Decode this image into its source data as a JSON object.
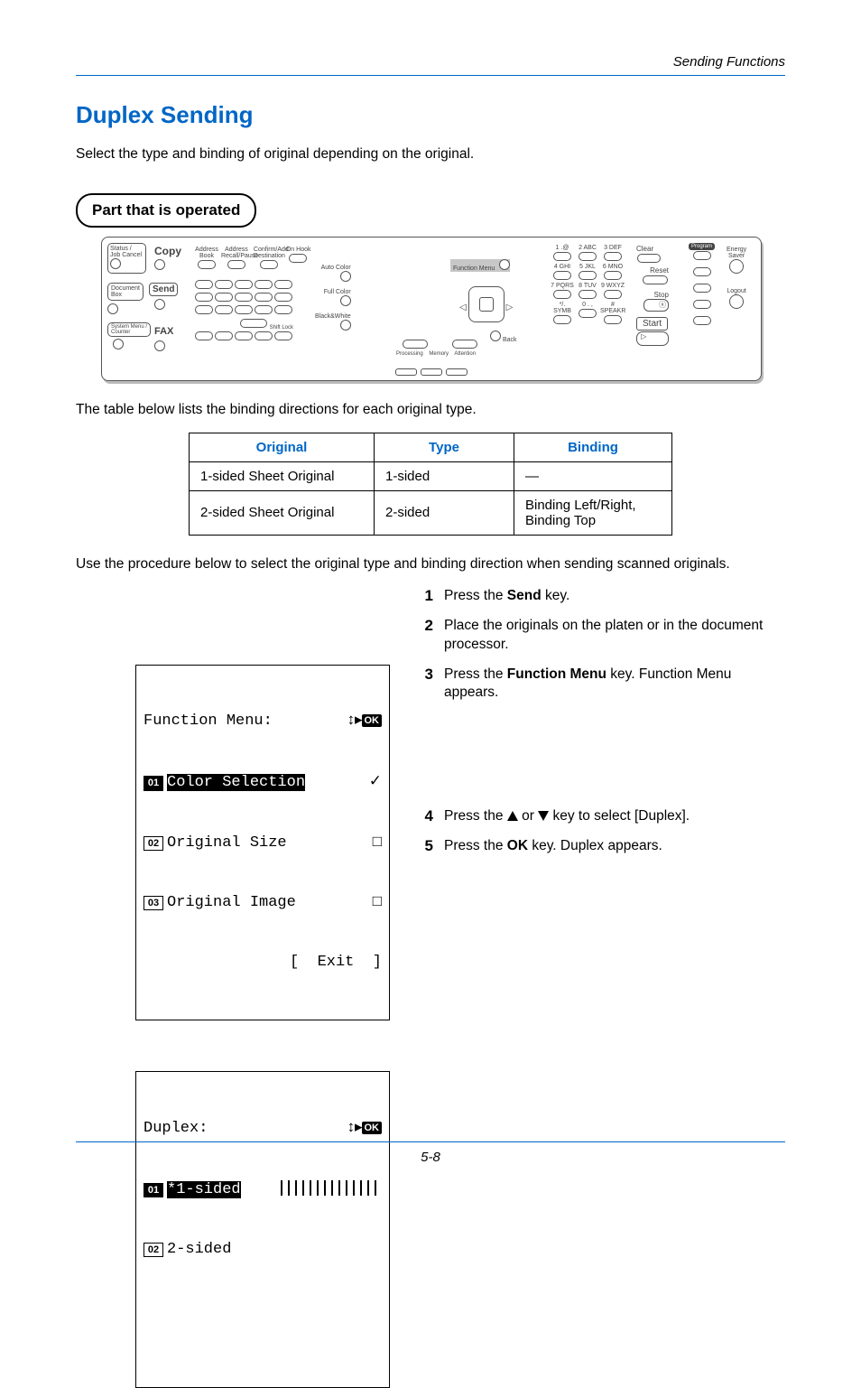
{
  "runhead": "Sending Functions",
  "h1": "Duplex Sending",
  "intro": "Select the type and binding of original depending on the original.",
  "pill": "Part that is operated",
  "panel": {
    "mode_labels": {
      "copy": "Copy",
      "send": "Send",
      "fax": "FAX",
      "status": "Status /",
      "jobcancel": "Job Cancel",
      "docbox": "Document\nBox",
      "sysmenu": "System Menu /\nCounter"
    },
    "small_btns": [
      "Address\nBook",
      "Address\nRecall/Pause",
      "Confirm/Add\nDestination",
      "On Hook"
    ],
    "color_btns": [
      "Auto Color",
      "Full Color",
      "Black&White"
    ],
    "shift": "Shift Lock",
    "center_label": "Function Menu",
    "center_highlight": "yes",
    "back": "Back",
    "indicators": [
      "Processing",
      "Memory",
      "Attention"
    ],
    "keypad": [
      [
        "1 .@",
        "2 ABC",
        "3 DEF"
      ],
      [
        "4 GHI",
        "5 JKL",
        "6 MNO"
      ],
      [
        "7 PQRS",
        "8 TUV",
        "9 WXYZ"
      ],
      [
        "*/. SYMB",
        "0 . ,",
        "# SPEAKR"
      ]
    ],
    "right_col": [
      "Clear",
      "Reset",
      "Stop",
      "Start"
    ],
    "far_right": [
      "Program",
      "Energy\nSaver",
      "Logout"
    ]
  },
  "table_intro": "The table below lists the binding directions for each original type.",
  "table": {
    "headers": [
      "Original",
      "Type",
      "Binding"
    ],
    "rows": [
      [
        "1-sided Sheet Original",
        "1-sided",
        "—"
      ],
      [
        "2-sided Sheet Original",
        "2-sided",
        "Binding Left/Right, Binding Top"
      ]
    ]
  },
  "procedure_intro": "Use the procedure below to select the original type and binding direction when sending scanned originals.",
  "steps": {
    "s1_a": "Press the ",
    "s1_b": "Send",
    "s1_c": " key.",
    "s2": "Place the originals on the platen or in the document processor.",
    "s3_a": "Press the ",
    "s3_b": "Function Menu",
    "s3_c": " key. Function Menu appears.",
    "s4_a": "Press the ",
    "s4_b": " or ",
    "s4_c": " key to select [Duplex].",
    "s5_a": "Press the ",
    "s5_b": "OK",
    "s5_c": " key. Duplex appears."
  },
  "lcd1": {
    "title": "Function Menu:",
    "items": [
      {
        "n": "01",
        "label": "Color Selection",
        "sel": true,
        "rt": "tick"
      },
      {
        "n": "02",
        "label": "Original Size",
        "sel": false,
        "rt": "sq"
      },
      {
        "n": "03",
        "label": "Original Image",
        "sel": false,
        "rt": "sq"
      }
    ],
    "soft": "[  Exit  ]"
  },
  "lcd2": {
    "title": "Duplex:",
    "items": [
      {
        "n": "01",
        "label": "*1-sided",
        "sel": true,
        "rt": "hatch"
      },
      {
        "n": "02",
        "label": "2-sided",
        "sel": false,
        "rt": ""
      }
    ]
  },
  "glyph": {
    "tick": "g",
    "sq": "T",
    "ok": "b",
    "arrows": "ab"
  },
  "pagenum": "5-8"
}
